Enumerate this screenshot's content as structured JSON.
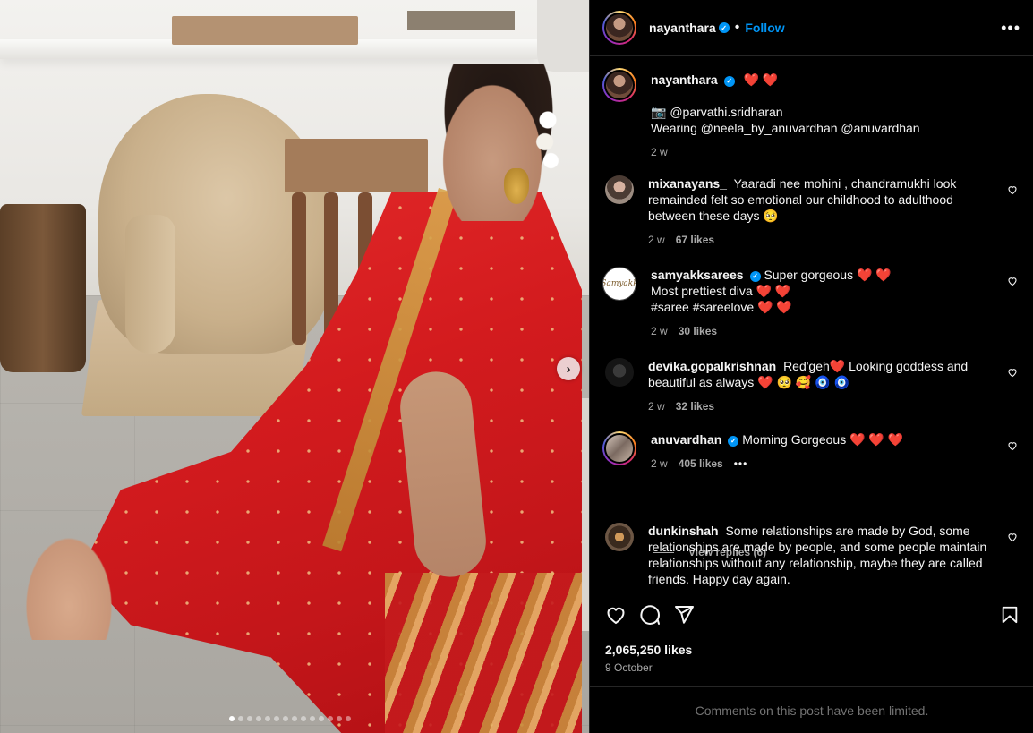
{
  "post": {
    "carousel_total": 14,
    "carousel_index": 1
  },
  "header": {
    "username": "nayanthara",
    "separator": "•",
    "follow_label": "Follow",
    "more_label": "•••"
  },
  "caption": {
    "username": "nayanthara",
    "hearts": "❤️ ❤️",
    "line1": "📷 @parvathi.sridharan",
    "line2": "Wearing @neela_by_anuvardhan @anuvardhan",
    "time": "2 w"
  },
  "comments": [
    {
      "username": "mixanayans_",
      "verified": false,
      "text": "Yaaradi nee mohini , chandramukhi look remainded felt so emotional our childhood to adulthood between these days 🥺",
      "time": "2 w",
      "likes": "67 likes",
      "avatar": "mix"
    },
    {
      "username": "samyakksarees",
      "verified": true,
      "text": "Super gorgeous ❤️ ❤️\nMost prettiest diva ❤️ ❤️\n#saree #sareelove ❤️ ❤️",
      "time": "2 w",
      "likes": "30 likes",
      "avatar": "sam",
      "avatar_text": "Samyakk"
    },
    {
      "username": "devika.gopalkrishnan",
      "verified": false,
      "text": "Red'geh❤️ Looking goddess and beautiful as always ❤️ 🥺 🥰 🧿 🧿",
      "time": "2 w",
      "likes": "32 likes",
      "avatar": "dev"
    },
    {
      "username": "anuvardhan",
      "verified": true,
      "text": "Morning Gorgeous ❤️ ❤️ ❤️",
      "time": "2 w",
      "likes": "405 likes",
      "extra": "•••",
      "avatar": "anu"
    },
    {
      "username": "dunkinshah",
      "verified": false,
      "text": "Some relationships are made by God, some relationships are made by people, and some people maintain relationships without any relationship, maybe they are called friends. Happy day again.",
      "time": "",
      "likes": "",
      "avatar": "dun"
    }
  ],
  "view_replies": "View replies (6)",
  "stats": {
    "likes": "2,065,250 likes",
    "date": "9 October"
  },
  "footer": {
    "limited": "Comments on this post have been limited."
  },
  "icons": {
    "like": "heart-icon",
    "comment": "comment-icon",
    "share": "share-icon",
    "save": "bookmark-icon",
    "next": "chevron-right-icon"
  },
  "colors": {
    "accent": "#0095f6",
    "heart": "#ed4956",
    "background": "#000000",
    "muted": "#a8a8a8"
  }
}
